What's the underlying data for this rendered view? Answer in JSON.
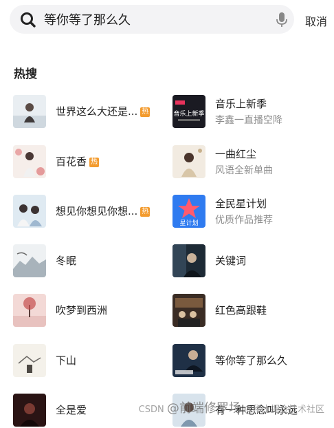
{
  "search": {
    "value": "等你等了那么久",
    "cancel_label": "取消"
  },
  "hot": {
    "title": "热搜",
    "badge_label": "热",
    "items": [
      {
        "title": "世界这么大还是...",
        "hot": true,
        "subtitle": ""
      },
      {
        "title": "音乐上新季",
        "hot": false,
        "subtitle": "李鑫一直播空降"
      },
      {
        "title": "百花香",
        "hot": true,
        "subtitle": ""
      },
      {
        "title": "一曲红尘",
        "hot": false,
        "subtitle": "风语全新单曲"
      },
      {
        "title": "想见你想见你想...",
        "hot": true,
        "subtitle": ""
      },
      {
        "title": "全民星计划",
        "hot": false,
        "subtitle": "优质作品推荐"
      },
      {
        "title": "冬眠",
        "hot": false,
        "subtitle": ""
      },
      {
        "title": "关键词",
        "hot": false,
        "subtitle": ""
      },
      {
        "title": "吹梦到西洲",
        "hot": false,
        "subtitle": ""
      },
      {
        "title": "红色高跟鞋",
        "hot": false,
        "subtitle": ""
      },
      {
        "title": "下山",
        "hot": false,
        "subtitle": ""
      },
      {
        "title": "等你等了那么久",
        "hot": false,
        "subtitle": ""
      },
      {
        "title": "全是爱",
        "hot": false,
        "subtitle": ""
      },
      {
        "title": "有一种思念叫永远",
        "hot": false,
        "subtitle": ""
      }
    ]
  },
  "cover_text": {
    "live_title": "音乐上新季",
    "star_label": "星计划"
  },
  "watermark": {
    "csdn": "CSDN",
    "author": "@前端修罗场",
    "community": "@稀土掘金技术社区"
  },
  "colors": {
    "accent": "#f39b2e",
    "star_badge": "#2f7bf0"
  }
}
